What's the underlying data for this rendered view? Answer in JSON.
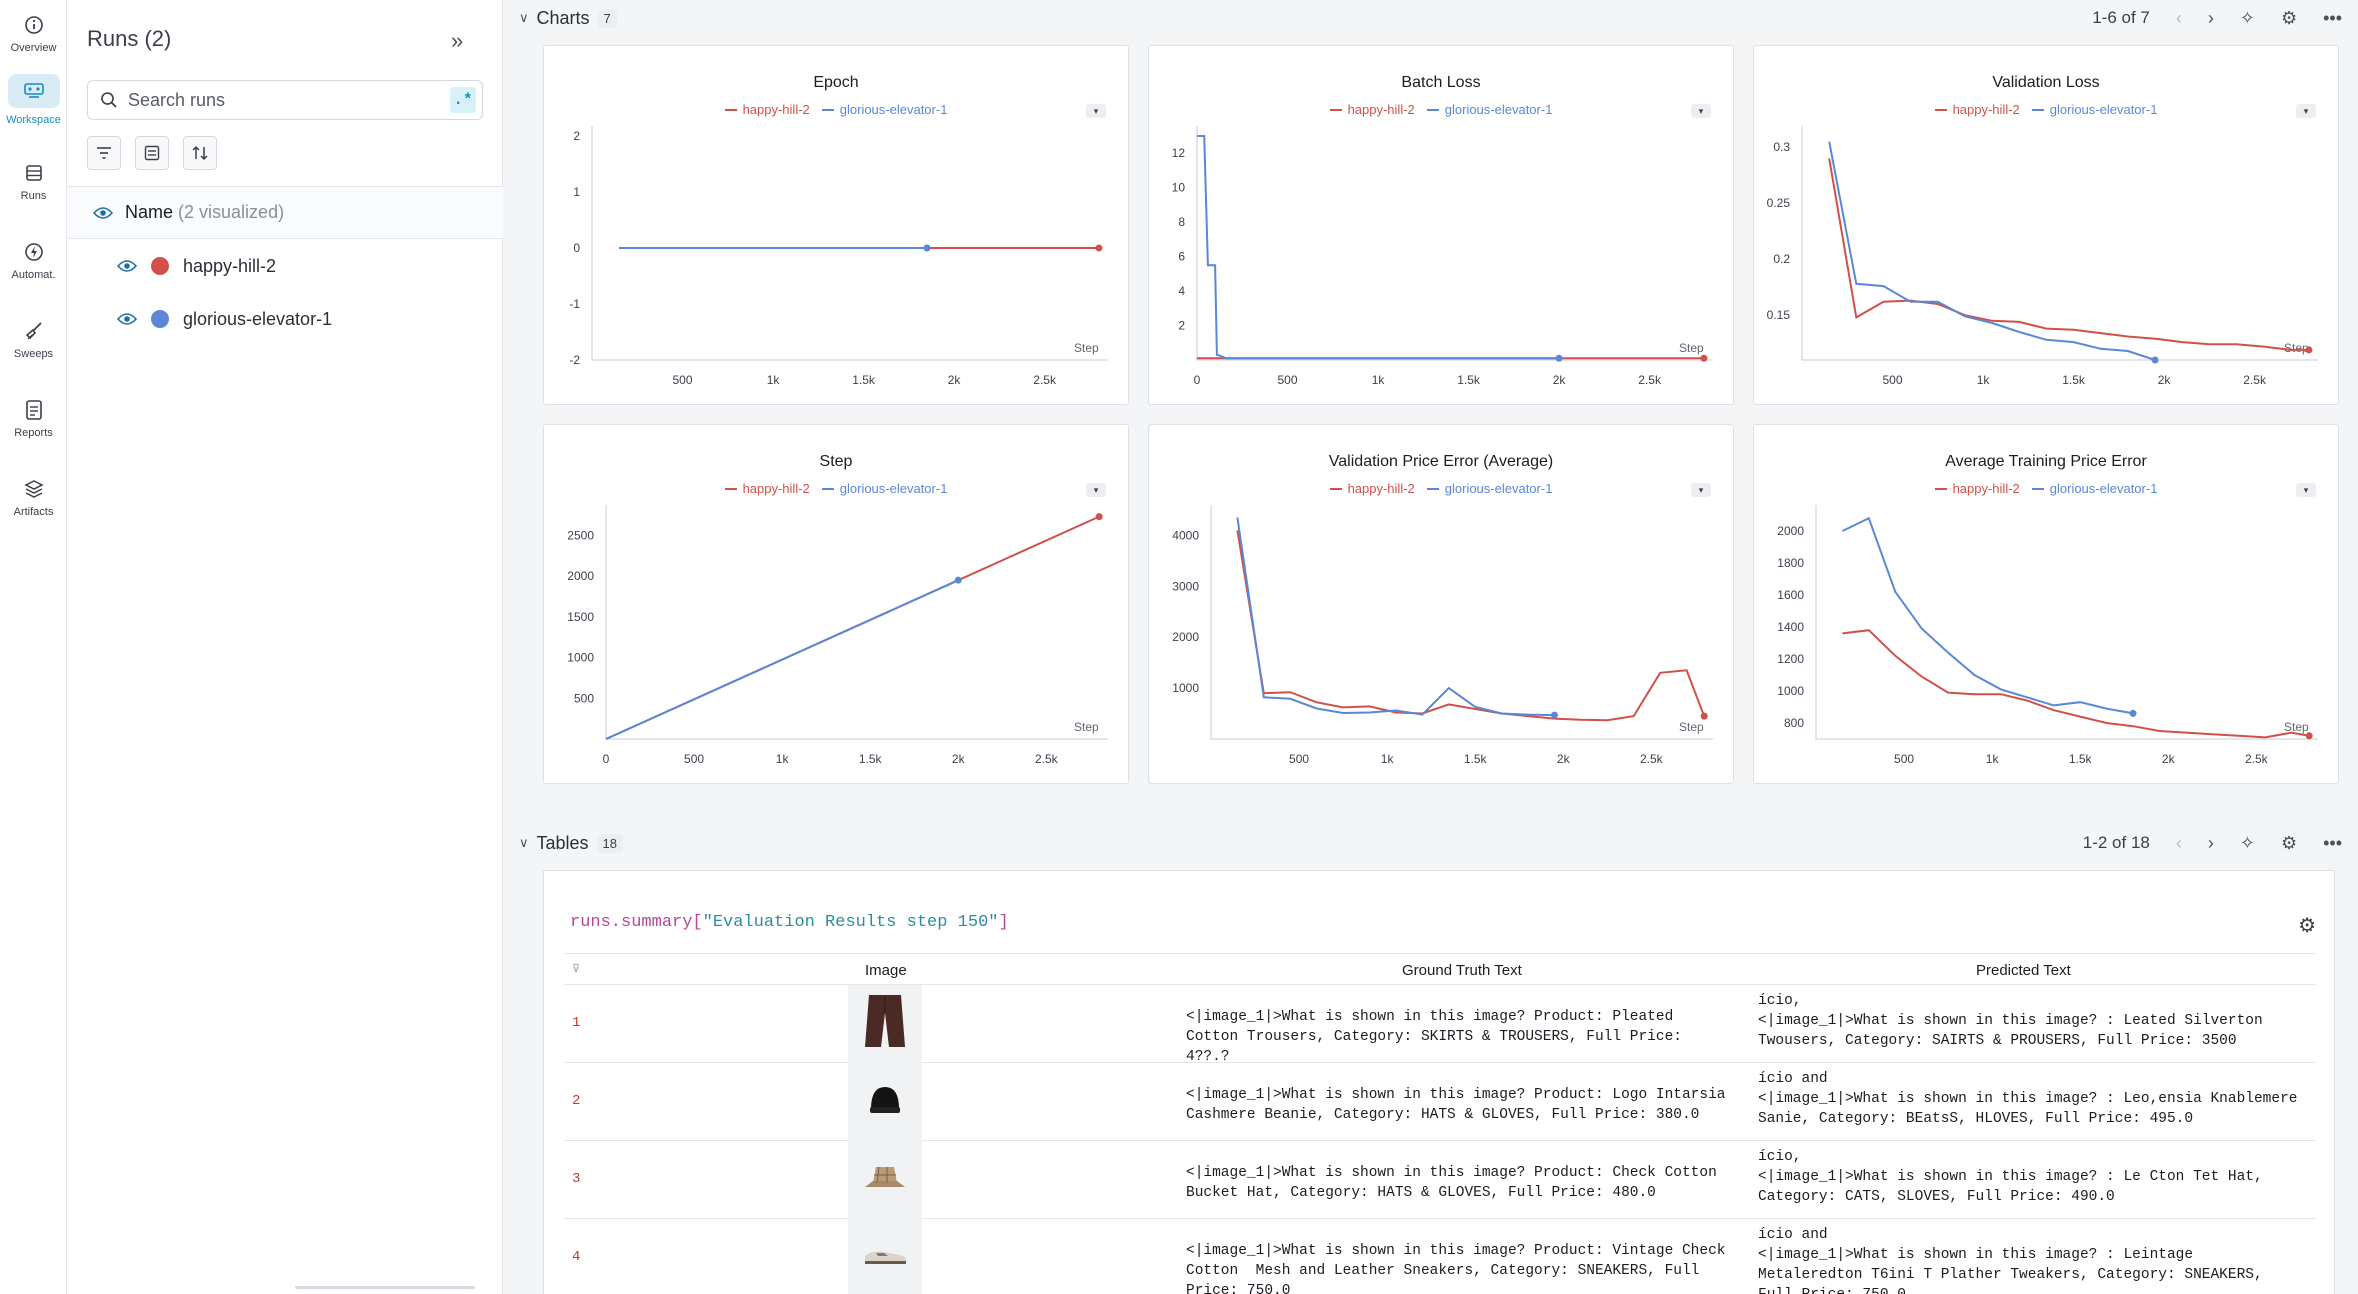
{
  "nav": [
    {
      "label": "Overview",
      "icon": "info-icon"
    },
    {
      "label": "Workspace",
      "icon": "workspace-icon",
      "active": true
    },
    {
      "label": "Runs",
      "icon": "table-icon"
    },
    {
      "label": "Automat.",
      "icon": "automation-icon"
    },
    {
      "label": "Sweeps",
      "icon": "broom-icon"
    },
    {
      "label": "Reports",
      "icon": "report-icon"
    },
    {
      "label": "Artifacts",
      "icon": "layers-icon"
    }
  ],
  "runs_panel": {
    "title": "Runs (2)",
    "search_placeholder": "Search runs",
    "regex_label": ".*",
    "name_label": "Name",
    "name_sub": "(2 visualized)",
    "runs": [
      {
        "name": "happy-hill-2",
        "color": "#d1514a"
      },
      {
        "name": "glorious-elevator-1",
        "color": "#5a87d6"
      }
    ]
  },
  "charts_section": {
    "title": "Charts",
    "count": "7",
    "pager": "1-6 of 7"
  },
  "tables_section": {
    "title": "Tables",
    "count": "18",
    "pager": "1-2 of 18"
  },
  "colors": {
    "red": "#d1514a",
    "blue": "#5a87d6"
  },
  "legend": [
    "happy-hill-2",
    "glorious-elevator-1"
  ],
  "chart_data": [
    {
      "type": "line",
      "title": "Epoch",
      "xlabel": "Step",
      "xticks": [
        "500",
        "1k",
        "1.5k",
        "2k",
        "2.5k"
      ],
      "yticks": [
        "2",
        "1",
        "0",
        "-1",
        "-2"
      ],
      "series": [
        {
          "name": "happy-hill-2",
          "x": [
            150,
            2800
          ],
          "y": [
            0,
            0
          ]
        },
        {
          "name": "glorious-elevator-1",
          "x": [
            150,
            1850
          ],
          "y": [
            0,
            0
          ]
        }
      ]
    },
    {
      "type": "line",
      "title": "Batch Loss",
      "xlabel": "Step",
      "xticks": [
        "0",
        "500",
        "1k",
        "1.5k",
        "2k",
        "2.5k"
      ],
      "yticks": [
        "12",
        "10",
        "8",
        "6",
        "4",
        "2"
      ],
      "series": [
        {
          "name": "happy-hill-2",
          "x": [
            0,
            2000,
            2800
          ],
          "y": [
            0.1,
            0.1,
            0.1
          ]
        },
        {
          "name": "glorious-elevator-1",
          "x": [
            0,
            40,
            60,
            100,
            110,
            140,
            160,
            2000
          ],
          "y": [
            13,
            13,
            5.5,
            5.5,
            0.3,
            0.2,
            0.1,
            0.1
          ]
        }
      ]
    },
    {
      "type": "line",
      "title": "Validation Loss",
      "xlabel": "Step",
      "xticks": [
        "500",
        "1k",
        "1.5k",
        "2k",
        "2.5k"
      ],
      "yticks": [
        "0.3",
        "0.25",
        "0.2",
        "0.15"
      ],
      "series": [
        {
          "name": "happy-hill-2",
          "x": [
            150,
            300,
            450,
            600,
            750,
            900,
            1050,
            1200,
            1350,
            1500,
            1650,
            1800,
            1950,
            2100,
            2250,
            2400,
            2550,
            2700,
            2800
          ],
          "y": [
            0.29,
            0.148,
            0.162,
            0.163,
            0.16,
            0.15,
            0.145,
            0.144,
            0.138,
            0.137,
            0.134,
            0.131,
            0.129,
            0.126,
            0.124,
            0.124,
            0.122,
            0.119,
            0.119
          ]
        },
        {
          "name": "glorious-elevator-1",
          "x": [
            150,
            300,
            450,
            600,
            750,
            900,
            1050,
            1200,
            1350,
            1500,
            1650,
            1800,
            1950
          ],
          "y": [
            0.305,
            0.178,
            0.176,
            0.162,
            0.162,
            0.149,
            0.143,
            0.135,
            0.128,
            0.126,
            0.12,
            0.118,
            0.11
          ]
        }
      ]
    },
    {
      "type": "line",
      "title": "Step",
      "xlabel": "Step",
      "xticks": [
        "0",
        "500",
        "1k",
        "1.5k",
        "2k",
        "2.5k"
      ],
      "yticks": [
        "2500",
        "2000",
        "1500",
        "1000",
        "500"
      ],
      "series": [
        {
          "name": "happy-hill-2",
          "x": [
            0,
            2000,
            2800
          ],
          "y": [
            0,
            1950,
            2730
          ]
        },
        {
          "name": "glorious-elevator-1",
          "x": [
            0,
            2000
          ],
          "y": [
            0,
            1950
          ]
        }
      ]
    },
    {
      "type": "line",
      "title": "Validation Price Error (Average)",
      "xlabel": "Step",
      "xticks": [
        "500",
        "1k",
        "1.5k",
        "2k",
        "2.5k"
      ],
      "yticks": [
        "4000",
        "3000",
        "2000",
        "1000"
      ],
      "series": [
        {
          "name": "happy-hill-2",
          "x": [
            150,
            300,
            450,
            600,
            750,
            900,
            1050,
            1200,
            1350,
            1500,
            1650,
            1800,
            1950,
            2100,
            2250,
            2400,
            2550,
            2700,
            2800
          ],
          "y": [
            4100,
            900,
            920,
            720,
            620,
            640,
            520,
            500,
            680,
            590,
            500,
            450,
            400,
            380,
            370,
            450,
            1300,
            1350,
            450
          ]
        },
        {
          "name": "glorious-elevator-1",
          "x": [
            150,
            300,
            450,
            600,
            750,
            900,
            1050,
            1200,
            1350,
            1500,
            1650,
            1800,
            1950
          ],
          "y": [
            4350,
            820,
            790,
            600,
            510,
            520,
            560,
            480,
            1000,
            630,
            500,
            480,
            470
          ]
        }
      ]
    },
    {
      "type": "line",
      "title": "Average Training Price Error",
      "xlabel": "Step",
      "xticks": [
        "500",
        "1k",
        "1.5k",
        "2k",
        "2.5k"
      ],
      "yticks": [
        "2000",
        "1800",
        "1600",
        "1400",
        "1200",
        "1000",
        "800"
      ],
      "series": [
        {
          "name": "happy-hill-2",
          "x": [
            150,
            300,
            450,
            600,
            750,
            900,
            1050,
            1200,
            1350,
            1500,
            1650,
            1800,
            1950,
            2100,
            2250,
            2400,
            2550,
            2700,
            2800
          ],
          "y": [
            1360,
            1380,
            1220,
            1090,
            990,
            980,
            980,
            940,
            880,
            840,
            800,
            780,
            750,
            740,
            730,
            720,
            710,
            740,
            720
          ]
        },
        {
          "name": "glorious-elevator-1",
          "x": [
            150,
            300,
            450,
            600,
            750,
            900,
            1050,
            1200,
            1350,
            1500,
            1650,
            1800
          ],
          "y": [
            2000,
            2080,
            1620,
            1390,
            1240,
            1100,
            1010,
            960,
            910,
            930,
            890,
            860
          ]
        }
      ]
    }
  ],
  "table": {
    "title_prefix": "runs.summary[",
    "title_key": "\"Evaluation Results step 150\"",
    "title_suffix": "]",
    "headers": {
      "image": "Image",
      "gt": "Ground Truth Text",
      "pred": "Predicted Text"
    },
    "rows": [
      {
        "idx": "1",
        "img": "trousers-icon",
        "gt": "<|image_1|>What is shown in this image? Product: Pleated\nCotton Trousers, Category: SKIRTS & TROUSERS, Full Price:\n4??.?",
        "pred": "ício,\n<|image_1|>What is shown in this image? : Leated Silverton\nTwousers, Category: SAIRTS & PROUSERS, Full Price: 3500"
      },
      {
        "idx": "2",
        "img": "beanie-icon",
        "gt": "<|image_1|>What is shown in this image? Product: Logo Intarsia\nCashmere Beanie, Category: HATS & GLOVES, Full Price: 380.0",
        "pred": "ício and\n<|image_1|>What is shown in this image? : Leo,ensia Knablemere\nSanie, Category: BEatsS, HLOVES, Full Price: 495.0"
      },
      {
        "idx": "3",
        "img": "bucket-hat-icon",
        "gt": "<|image_1|>What is shown in this image? Product: Check Cotton\nBucket Hat, Category: HATS & GLOVES, Full Price: 480.0",
        "pred": "ício,\n<|image_1|>What is shown in this image? : Le Cton Tet Hat,\nCategory: CATS, SLOVES, Full Price: 490.0"
      },
      {
        "idx": "4",
        "img": "sneaker-icon",
        "gt": "<|image_1|>What is shown in this image? Product: Vintage Check\nCotton  Mesh and Leather Sneakers, Category: SNEAKERS, Full\nPrice: 750.0",
        "pred": "ício and\n<|image_1|>What is shown in this image? : Leintage\nMetaleredton T6ini T Plather Tweakers, Category: SNEAKERS,\nFull Price: 750.0"
      }
    ]
  }
}
